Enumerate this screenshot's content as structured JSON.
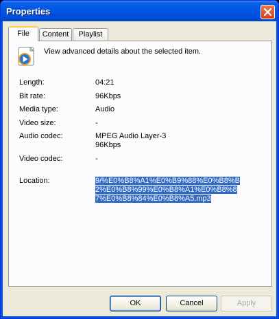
{
  "window": {
    "title": "Properties"
  },
  "tabs": [
    {
      "label": "File",
      "active": true
    },
    {
      "label": "Content",
      "active": false
    },
    {
      "label": "Playlist",
      "active": false
    }
  ],
  "file_tab": {
    "header_icon": "windows-media-player-icon",
    "description": "View advanced details about the selected item.",
    "fields": {
      "length": {
        "label": "Length:",
        "value": "04:21"
      },
      "bit_rate": {
        "label": "Bit rate:",
        "value": "96Kbps"
      },
      "media_type": {
        "label": "Media type:",
        "value": "Audio"
      },
      "video_size": {
        "label": "Video size:",
        "value": "-"
      },
      "audio_codec": {
        "label": "Audio codec:",
        "value_line1": "MPEG Audio Layer-3",
        "value_line2": "96Kbps"
      },
      "video_codec": {
        "label": "Video codec:",
        "value": "-"
      },
      "location": {
        "label": "Location:",
        "value": "9/%E0%B8%A1%E0%B9%88%E0%B8%B2%E0%B8%99%E0%B8%A1%E0%B8%87%E0%B8%84%E0%B8%A5.mp3"
      }
    }
  },
  "buttons": {
    "ok": "OK",
    "cancel": "Cancel",
    "apply": "Apply"
  },
  "colors": {
    "titlebar": "#0054e3",
    "selection": "#316ac5",
    "dialog_bg": "#ece9d8"
  }
}
